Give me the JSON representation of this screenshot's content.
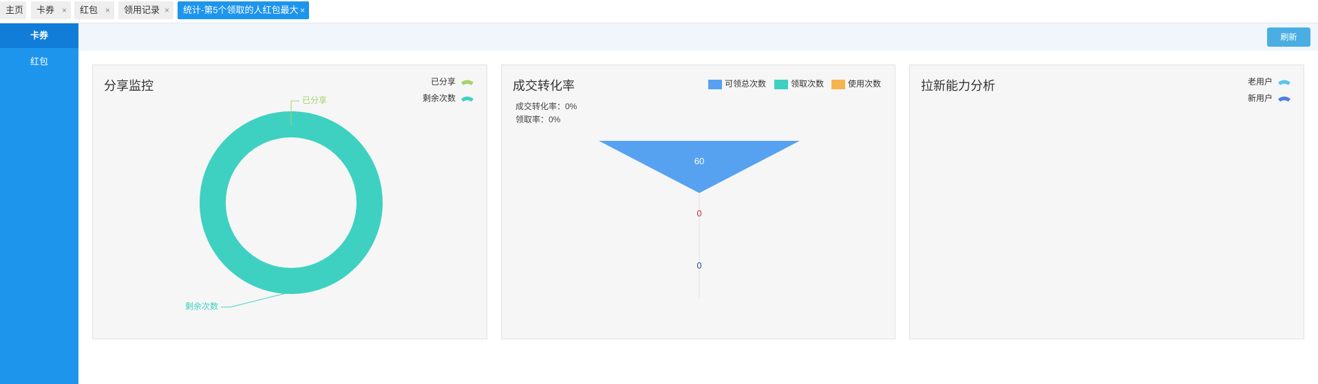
{
  "tabs": [
    {
      "label": "主页",
      "closable": false
    },
    {
      "label": "卡券",
      "closable": true
    },
    {
      "label": "红包",
      "closable": true
    },
    {
      "label": "领用记录",
      "closable": true
    },
    {
      "label": "统计-第5个领取的人红包最大",
      "closable": true,
      "active": true
    }
  ],
  "close_glyph": "×",
  "sidebar": {
    "items": [
      {
        "label": "卡券",
        "active": true
      },
      {
        "label": "红包"
      }
    ]
  },
  "toolbar": {
    "refresh_label": "刷新"
  },
  "panels": {
    "share": {
      "title": "分享监控",
      "legend": [
        {
          "label": "已分享",
          "color": "#a6d36b"
        },
        {
          "label": "剩余次数",
          "color": "#3ed1c1"
        }
      ],
      "labels": {
        "shared": "已分享",
        "remaining": "剩余次数"
      }
    },
    "conversion": {
      "title": "成交转化率",
      "legend": [
        {
          "label": "可领总次数",
          "color": "#57a2f0"
        },
        {
          "label": "领取次数",
          "color": "#3ed1c1"
        },
        {
          "label": "使用次数",
          "color": "#f7b44e"
        }
      ],
      "notes": {
        "conversion_rate": "成交转化率：0%",
        "claim_rate": "领取率：0%"
      }
    },
    "acquisition": {
      "title": "拉新能力分析",
      "legend": [
        {
          "label": "老用户",
          "color": "#5bc5ee"
        },
        {
          "label": "新用户",
          "color": "#4d7fe0"
        }
      ]
    }
  },
  "chart_data": [
    {
      "type": "pie",
      "subtype": "donut",
      "title": "分享监控",
      "slices": [
        {
          "name": "已分享",
          "value": 0
        },
        {
          "name": "剩余次数",
          "value": 1
        }
      ],
      "legend_position": "top-right"
    },
    {
      "type": "funnel",
      "title": "成交转化率",
      "stages": [
        {
          "name": "可领总次数",
          "value": 60
        },
        {
          "name": "领取次数",
          "value": 0
        },
        {
          "name": "使用次数",
          "value": 0
        }
      ],
      "max": 60,
      "legend_position": "top-right"
    },
    {
      "type": "pie",
      "title": "拉新能力分析",
      "slices": [
        {
          "name": "老用户"
        },
        {
          "name": "新用户"
        }
      ],
      "legend_position": "top-right"
    }
  ]
}
